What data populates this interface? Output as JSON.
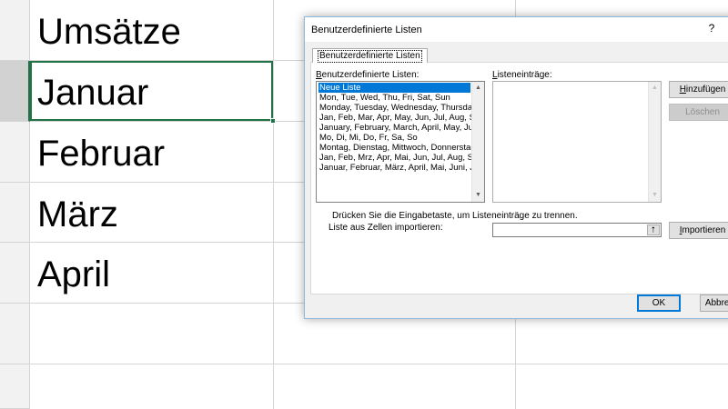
{
  "spreadsheet": {
    "cells": [
      "Umsätze",
      "Januar",
      "Februar",
      "März",
      "April"
    ]
  },
  "dialog": {
    "title": "Benutzerdefinierte Listen",
    "help": "?",
    "tab_label": "Benutzerdefinierte Listen",
    "lists_label_first": "B",
    "lists_label_rest": "enutzerdefinierte Listen:",
    "entries_label_first": "L",
    "entries_label_rest": "isteneinträge:",
    "lists": [
      "Neue Liste",
      "Mon, Tue, Wed, Thu, Fri, Sat, Sun",
      "Monday, Tuesday, Wednesday, Thursday, Friday",
      "Jan, Feb, Mar, Apr, May, Jun, Jul, Aug, Sep",
      "January, February, March, April, May, June",
      "Mo, Di, Mi, Do, Fr, Sa, So",
      "Montag, Dienstag, Mittwoch, Donnerstag",
      "Jan, Feb, Mrz, Apr, Mai, Jun, Jul, Aug, Sep",
      "Januar, Februar, März, April, Mai, Juni, Juli"
    ],
    "add_button_first": "H",
    "add_button_rest": "inzufügen",
    "delete_button": "Löschen",
    "hint": "Drücken Sie die Eingabetaste, um Listeneinträge zu trennen.",
    "import_label": "Liste aus Zellen importieren:",
    "import_button_first": "I",
    "import_button_rest": "mportieren",
    "ok_button": "OK",
    "cancel_button": "Abbrechen",
    "picker_icon": "range-picker-up-arrow-icon"
  },
  "colors": {
    "excel_green": "#217346",
    "selection_blue": "#0078d7"
  }
}
